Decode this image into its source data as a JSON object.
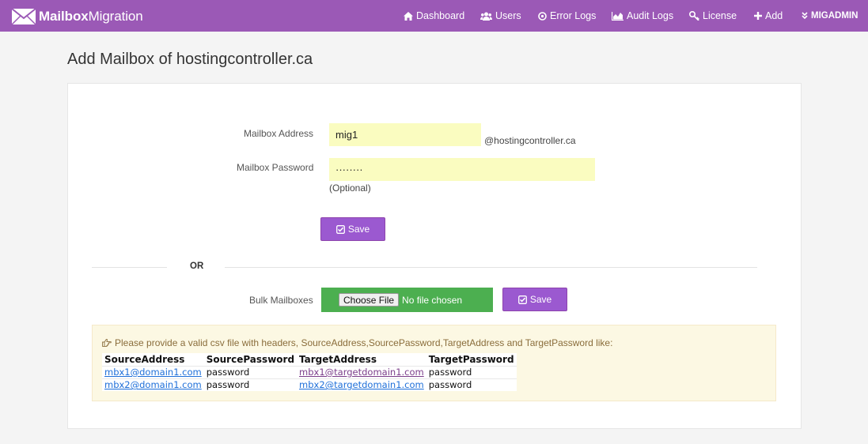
{
  "navbar": {
    "brand_bold": "Mailbox",
    "brand_rest": "Migration",
    "items": [
      {
        "label": "Dashboard",
        "icon": "home-icon"
      },
      {
        "label": "Users",
        "icon": "users-icon"
      },
      {
        "label": "Error Logs",
        "icon": "error-icon"
      },
      {
        "label": "Audit Logs",
        "icon": "chart-icon"
      },
      {
        "label": "License",
        "icon": "key-icon"
      },
      {
        "label": "Add",
        "icon": "plus-icon"
      },
      {
        "label": "MIGADMIN",
        "icon": "double-chevron-down-icon"
      }
    ],
    "color": "#9b59b6"
  },
  "page": {
    "title": "Add Mailbox of hostingcontroller.ca"
  },
  "form": {
    "address_label": "Mailbox Address",
    "address_value": "mig1",
    "domain_suffix": "@hostingcontroller.ca",
    "password_label": "Mailbox Password",
    "password_value": "········",
    "password_hint": "(Optional)",
    "save_label": "Save"
  },
  "separator": {
    "text": "OR"
  },
  "bulk": {
    "label": "Bulk Mailboxes",
    "choose_label": "Choose File",
    "no_file_text": "No file chosen",
    "save_label": "Save"
  },
  "notice": {
    "message": "Please provide a valid csv file with headers, SourceAddress,SourcePassword,TargetAddress and TargetPassword like:",
    "headers": [
      "SourceAddress",
      "SourcePassword",
      "TargetAddress",
      "TargetPassword"
    ],
    "rows": [
      [
        "mbx1@domain1.com",
        "password",
        "mbx1@targetdomain1.com",
        "password"
      ],
      [
        "mbx2@domain1.com",
        "password",
        "mbx2@targetdomain1.com",
        "password"
      ]
    ]
  },
  "colors": {
    "accent": "#9b59b6",
    "input_bg": "#fafcc0",
    "file_bg": "#4caf50",
    "alert_bg": "#fcf8e3"
  }
}
